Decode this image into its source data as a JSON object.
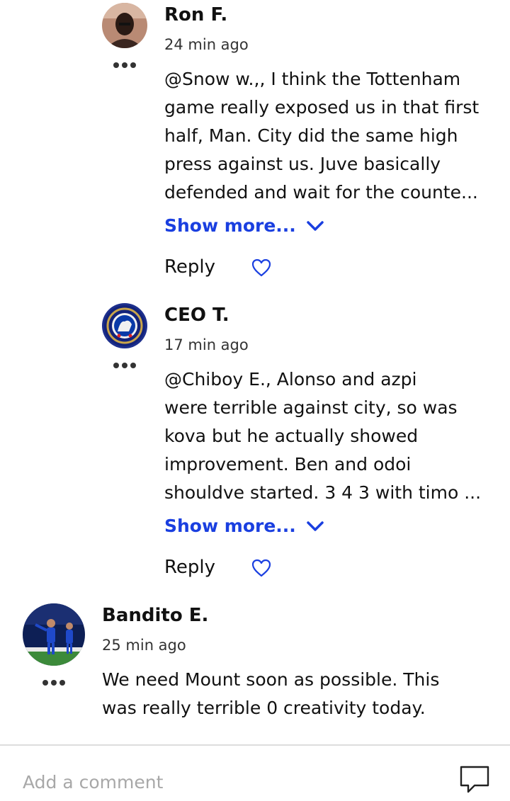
{
  "comments": [
    {
      "author": "Ron F.",
      "time": "24 min ago",
      "lines": [
        "@Snow w.,, I think the Tottenham",
        "game really exposed us in that first",
        "half, Man. City did the same high",
        "press against us. Juve basically",
        "defended and wait for the counte..."
      ],
      "show_more": "Show more...",
      "reply": "Reply"
    },
    {
      "author": "CEO T.",
      "time": "17 min ago",
      "lines": [
        "@Chiboy E., Alonso and azpi",
        "were terrible against city, so was",
        "kova but he actually showed",
        "improvement. Ben and odoi",
        "shouldve started. 3 4 3 with timo ..."
      ],
      "show_more": "Show more...",
      "reply": "Reply"
    },
    {
      "author": "Bandito E.",
      "time": "25 min ago",
      "lines": [
        "We need Mount soon as possible. This",
        "was really terrible 0 creativity today."
      ]
    }
  ],
  "composer": {
    "placeholder": "Add a comment"
  },
  "icons": {
    "more": "more-dots-icon",
    "chevron": "chevron-down-icon",
    "heart": "heart-outline-icon",
    "comment": "speech-bubble-icon"
  },
  "colors": {
    "link": "#1a3fe0",
    "text": "#111111",
    "placeholder": "#a8a8a8"
  }
}
